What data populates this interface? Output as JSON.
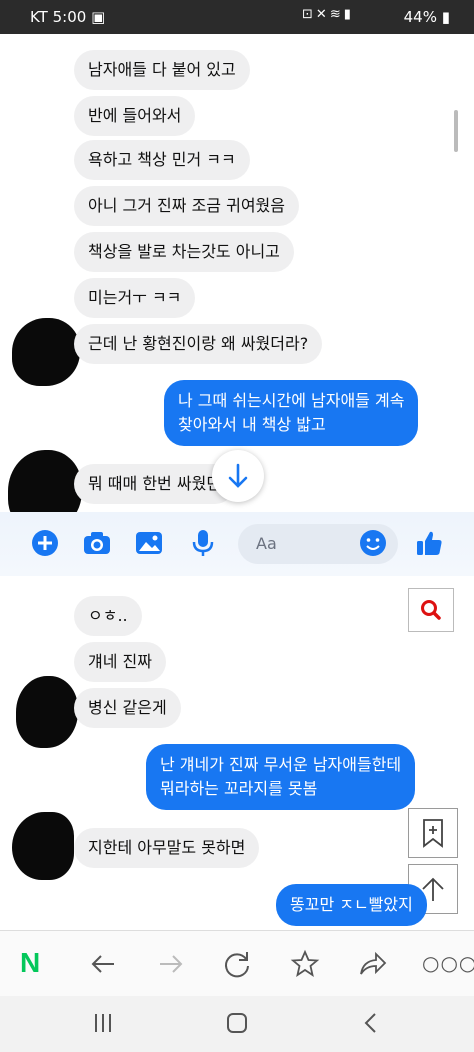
{
  "status_bar": {
    "carrier": "KT",
    "time": "5:00",
    "battery": "44%"
  },
  "chat_top": {
    "incoming": [
      "남자애들 다 붙어 있고",
      "반에 들어와서",
      "욕하고 책상 민거 ㅋㅋ",
      "아니 그거 진짜 조금 귀여웠음",
      "책상을 발로 차는갓도 아니고",
      "미는거ㅜ ㅋㅋ",
      "근데 난 황현진이랑 왜 싸웠더라?"
    ],
    "outgoing": [
      "나 그때 쉬는시간에 남자애들 계속",
      "찾아와서 내 책상 밟고"
    ],
    "incoming_after": "뭐 때매 한번 싸웠던"
  },
  "composer": {
    "placeholder": "Aa"
  },
  "chat_bottom": {
    "incoming": [
      "ㅇㅎ..",
      "걔네 진짜",
      "병신 같은게"
    ],
    "outgoing": [
      "난 걔네가 진짜 무서운 남자애들한테",
      "뭐라하는 꼬라지를 못봄"
    ],
    "incoming_after": "지한테 아무말도 못하면",
    "outgoing_last": "똥꼬만 ㅈㄴ빨았지"
  },
  "colors": {
    "messenger_blue": "#1877f2",
    "incoming_bubble": "#efeff0",
    "naver_green": "#03c75a"
  },
  "icons": [
    "plus-icon",
    "camera-icon",
    "image-icon",
    "mic-icon",
    "emoji-icon",
    "thumbs-up-icon",
    "search-icon",
    "bookmark-icon",
    "back-icon",
    "forward-icon",
    "refresh-icon",
    "star-icon",
    "share-icon",
    "more-icon",
    "recents-icon",
    "home-icon",
    "nav-back-icon"
  ],
  "browser": {
    "logo": "N"
  }
}
